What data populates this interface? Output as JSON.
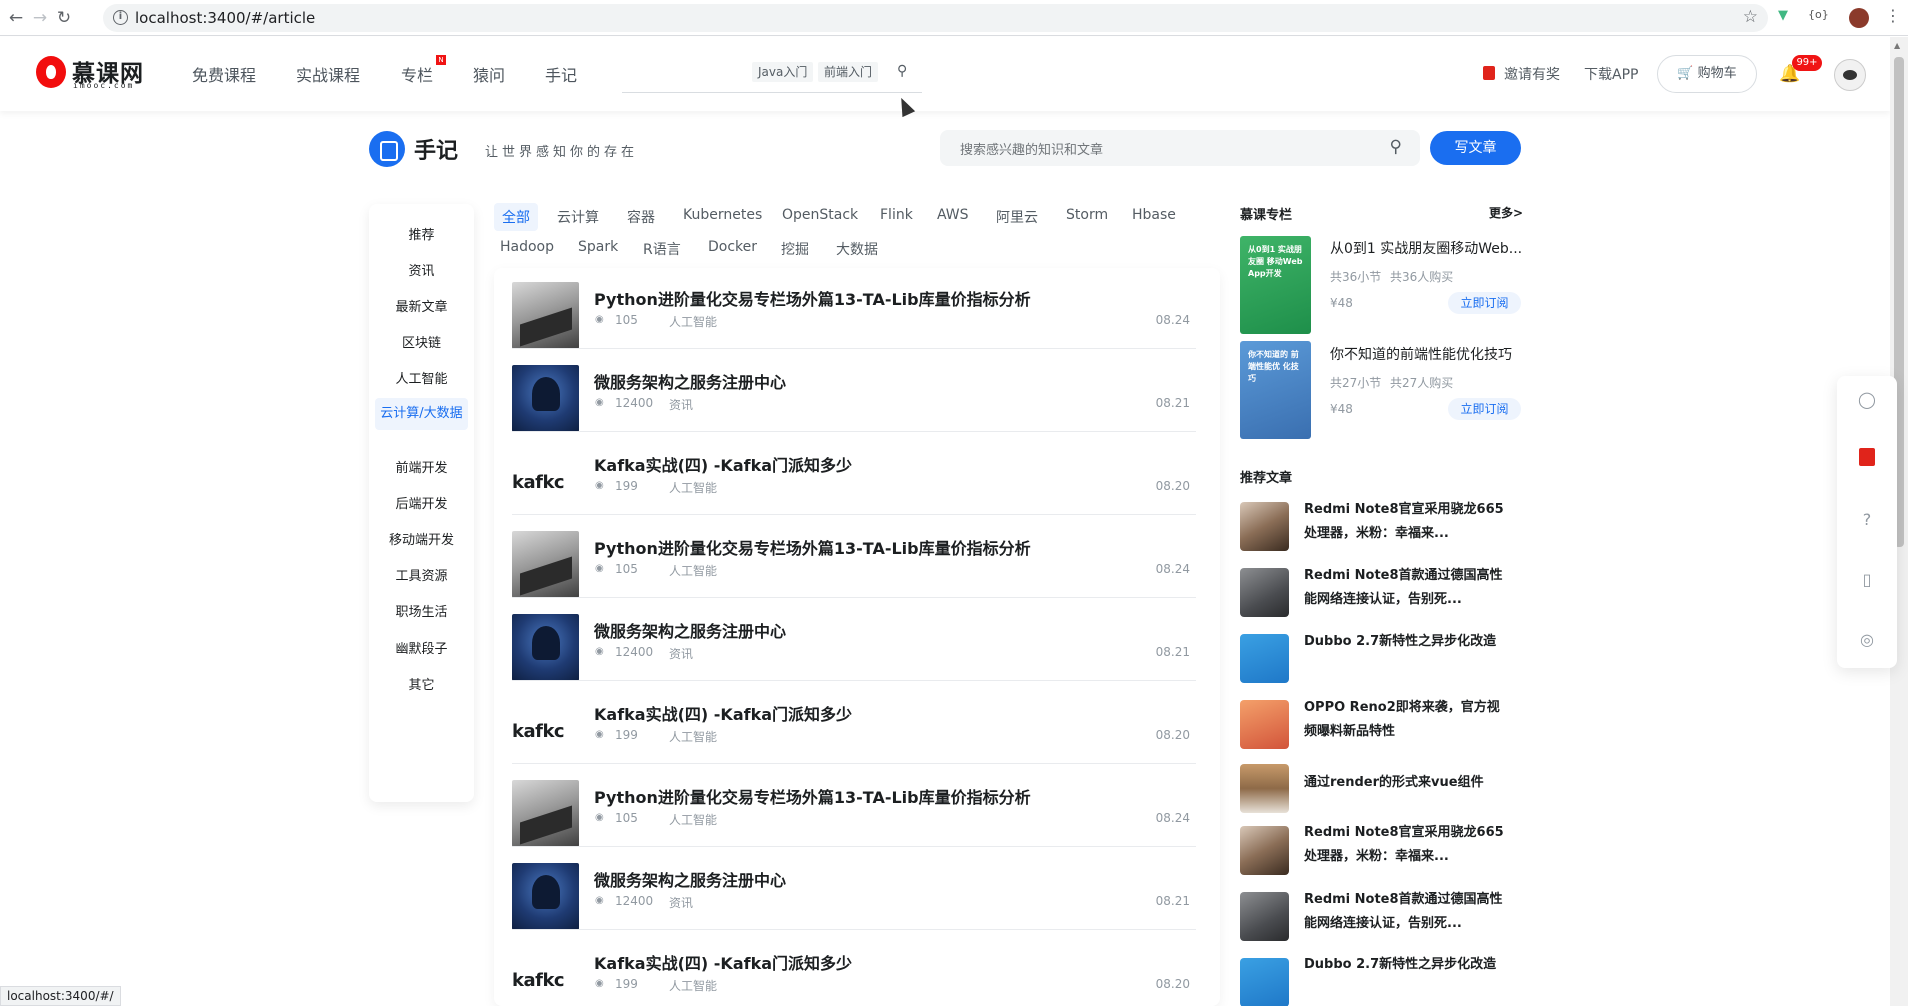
{
  "browser": {
    "url": "localhost:3400/#/article",
    "status_url": "localhost:3400/#/"
  },
  "header": {
    "logo_text": "慕课网",
    "logo_sub": "imooc.com",
    "nav": [
      "免费课程",
      "实战课程",
      "专栏",
      "猿问",
      "手记"
    ],
    "nav_badge": "N",
    "search_tags": [
      "Java入门",
      "前端入门"
    ],
    "invite": "邀请有奖",
    "download": "下载APP",
    "cart": "购物车",
    "notify_count": "99+"
  },
  "page": {
    "title": "手记",
    "slogan": "让世界感知你的存在",
    "search_placeholder": "搜索感兴趣的知识和文章",
    "write_button": "写文章"
  },
  "left_menu": [
    {
      "label": "推荐",
      "active": false
    },
    {
      "label": "资讯",
      "active": false
    },
    {
      "label": "最新文章",
      "active": false
    },
    {
      "label": "区块链",
      "active": false
    },
    {
      "label": "人工智能",
      "active": false
    },
    {
      "label": "云计算/大数据",
      "active": true
    },
    {
      "label": "前端开发",
      "active": false
    },
    {
      "label": "后端开发",
      "active": false
    },
    {
      "label": "移动端开发",
      "active": false
    },
    {
      "label": "工具资源",
      "active": false
    },
    {
      "label": "职场生活",
      "active": false
    },
    {
      "label": "幽默段子",
      "active": false
    },
    {
      "label": "其它",
      "active": false
    }
  ],
  "tags_row1": [
    "全部",
    "云计算",
    "容器",
    "Kubernetes",
    "OpenStack",
    "Flink",
    "AWS",
    "阿里云",
    "Storm",
    "Hbase"
  ],
  "tags_row2": [
    "Hadoop",
    "Spark",
    "R语言",
    "Docker",
    "挖掘",
    "大数据"
  ],
  "articles": [
    {
      "title": "Python进阶量化交易专栏场外篇13-TA-Lib库量价指标分析",
      "views": "105",
      "category": "人工智能",
      "date": "08.24",
      "thumb": "laptop"
    },
    {
      "title": "微服务架构之服务注册中心",
      "views": "12400",
      "category": "资讯",
      "date": "08.21",
      "thumb": "hacker"
    },
    {
      "title": "Kafka实战(四) -Kafka门派知多少",
      "views": "199",
      "category": "人工智能",
      "date": "08.20",
      "thumb": "kafka"
    },
    {
      "title": "Python进阶量化交易专栏场外篇13-TA-Lib库量价指标分析",
      "views": "105",
      "category": "人工智能",
      "date": "08.24",
      "thumb": "laptop"
    },
    {
      "title": "微服务架构之服务注册中心",
      "views": "12400",
      "category": "资讯",
      "date": "08.21",
      "thumb": "hacker"
    },
    {
      "title": "Kafka实战(四) -Kafka门派知多少",
      "views": "199",
      "category": "人工智能",
      "date": "08.20",
      "thumb": "kafka"
    },
    {
      "title": "Python进阶量化交易专栏场外篇13-TA-Lib库量价指标分析",
      "views": "105",
      "category": "人工智能",
      "date": "08.24",
      "thumb": "laptop"
    },
    {
      "title": "微服务架构之服务注册中心",
      "views": "12400",
      "category": "资讯",
      "date": "08.21",
      "thumb": "hacker"
    },
    {
      "title": "Kafka实战(四) -Kafka门派知多少",
      "views": "199",
      "category": "人工智能",
      "date": "08.20",
      "thumb": "kafka"
    }
  ],
  "kafka_logo": "kafkc",
  "columns": {
    "heading": "慕课专栏",
    "more": "更多>",
    "items": [
      {
        "title": "从0到1 实战朋友圈移动Web...",
        "cover_text": "从0到1 实战朋友圈 移动Web App开发",
        "sections": "共36小节",
        "buyers": "共36人购买",
        "price": "¥48",
        "button": "立即订阅",
        "cover": "green"
      },
      {
        "title": "你不知道的前端性能优化技巧",
        "cover_text": "你不知道的 前端性能优 化技巧",
        "sections": "共27小节",
        "buyers": "共27人购买",
        "price": "¥48",
        "button": "立即订阅",
        "cover": "blue"
      }
    ]
  },
  "recommend": {
    "heading": "推荐文章",
    "items": [
      {
        "title": "Redmi Note8官宣采用骁龙665处理器，米粉：幸福来...",
        "thumb": "laptop"
      },
      {
        "title": "Redmi Note8首款通过德国高性能网络连接认证，告别死...",
        "thumb": "person"
      },
      {
        "title": "Dubbo 2.7新特性之异步化改造",
        "thumb": "dubbo"
      },
      {
        "title": "OPPO Reno2即将来袭，官方视频曝料新品特性",
        "thumb": "oppo"
      },
      {
        "title": "通过render的形式来vue组件",
        "thumb": "road"
      },
      {
        "title": "Redmi Note8官宣采用骁龙665处理器，米粉：幸福来...",
        "thumb": "laptop"
      },
      {
        "title": "Redmi Note8首款通过德国高性能网络连接认证，告别死...",
        "thumb": "person"
      },
      {
        "title": "Dubbo 2.7新特性之异步化改造",
        "thumb": "dubbo"
      }
    ]
  },
  "colors": {
    "accent": "#1a6ef0",
    "brand_red": "#f20d0d",
    "badge_red": "#f01414"
  }
}
